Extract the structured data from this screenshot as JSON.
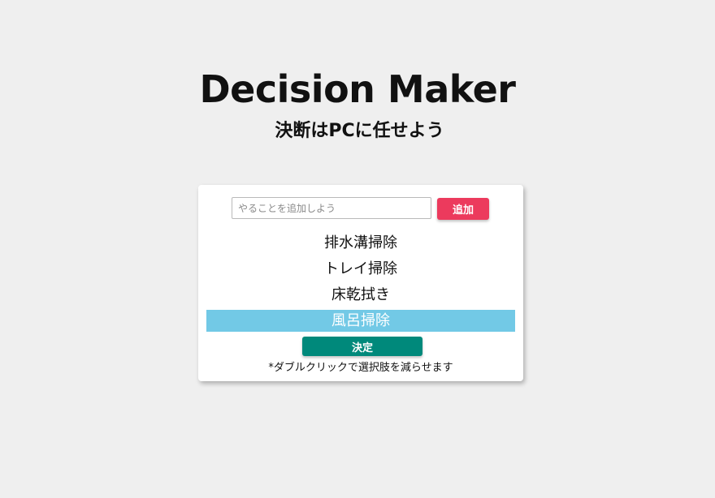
{
  "header": {
    "title": "Decision Maker",
    "subtitle": "決断はPCに任せよう"
  },
  "form": {
    "input_value": "",
    "input_placeholder": "やることを追加しよう",
    "add_label": "追加"
  },
  "choices": [
    {
      "label": "排水溝掃除",
      "selected": false
    },
    {
      "label": "トレイ掃除",
      "selected": false
    },
    {
      "label": "床乾拭き",
      "selected": false
    },
    {
      "label": "風呂掃除",
      "selected": true
    }
  ],
  "decide_label": "決定",
  "hint": "*ダブルクリックで選択肢を減らせます",
  "colors": {
    "background": "#efefef",
    "add_button": "#ec3a5d",
    "decide_button": "#00897b",
    "selected_item": "#72c9e6"
  }
}
